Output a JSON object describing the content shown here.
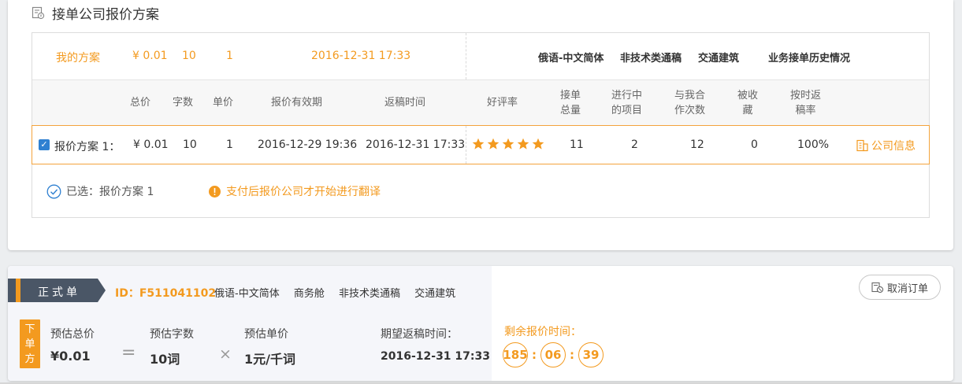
{
  "section": {
    "title": "接单公司报价方案"
  },
  "my_plan": {
    "label": "我的方案",
    "total": "¥ 0.01",
    "words": "10",
    "unit_price": "1",
    "deadline": "2016-12-31 17:33",
    "tags": [
      "俄语-中文简体",
      "非技术类通稿",
      "交通建筑"
    ],
    "history_label": "业务接单历史情况"
  },
  "table_header": {
    "total": "总价",
    "words": "字数",
    "unit_price": "单价",
    "quote_valid": "报价有效期",
    "return_time": "返稿时间",
    "rating": "好评率",
    "orders_total": [
      "接单",
      "总量"
    ],
    "in_progress": [
      "进行中",
      "的项目"
    ],
    "cooperations": [
      "与我合",
      "作次数"
    ],
    "favorited": [
      "被收",
      "藏"
    ],
    "on_time_rate": [
      "按时返",
      "稿率"
    ]
  },
  "plan_row": {
    "checked": true,
    "name": "报价方案 1：",
    "total": "¥ 0.01",
    "words": "10",
    "unit_price": "1",
    "quote_valid": "2016-12-29 19:36",
    "return_time": "2016-12-31 17:33",
    "rating_stars": 5,
    "orders_total": "11",
    "in_progress": "2",
    "cooperations": "12",
    "favorited": "0",
    "on_time_rate": "100%",
    "company_info_label": "公司信息"
  },
  "selection": {
    "selected_text": "已选：报价方案 1",
    "notice": "支付后报价公司才开始进行翻译"
  },
  "order": {
    "tag": "正式单",
    "id": "ID：F511041102",
    "meta": [
      "俄语-中文简体",
      "商务舱",
      "非技术类通稿",
      "交通建筑"
    ],
    "cancel_label": "取消订单",
    "orderer_badge": [
      "下",
      "单",
      "方"
    ],
    "est_total_label": "预估总价",
    "est_total_value": "¥0.01",
    "op_equals": "=",
    "est_words_label": "预估字数",
    "est_words_value": "10词",
    "op_times": "×",
    "est_unit_label": "预估单价",
    "est_unit_value": "1元/千词",
    "expected_return_label": "期望返稿时间：",
    "expected_return_value": "2016-12-31 17:33",
    "remaining_label": "剩余报价时间：",
    "timer": {
      "hours": "185",
      "minutes": "06",
      "seconds": "39"
    }
  },
  "colors": {
    "accent": "#f39a1f",
    "tag_dark": "#4a5666",
    "check_blue": "#2f80d1"
  }
}
